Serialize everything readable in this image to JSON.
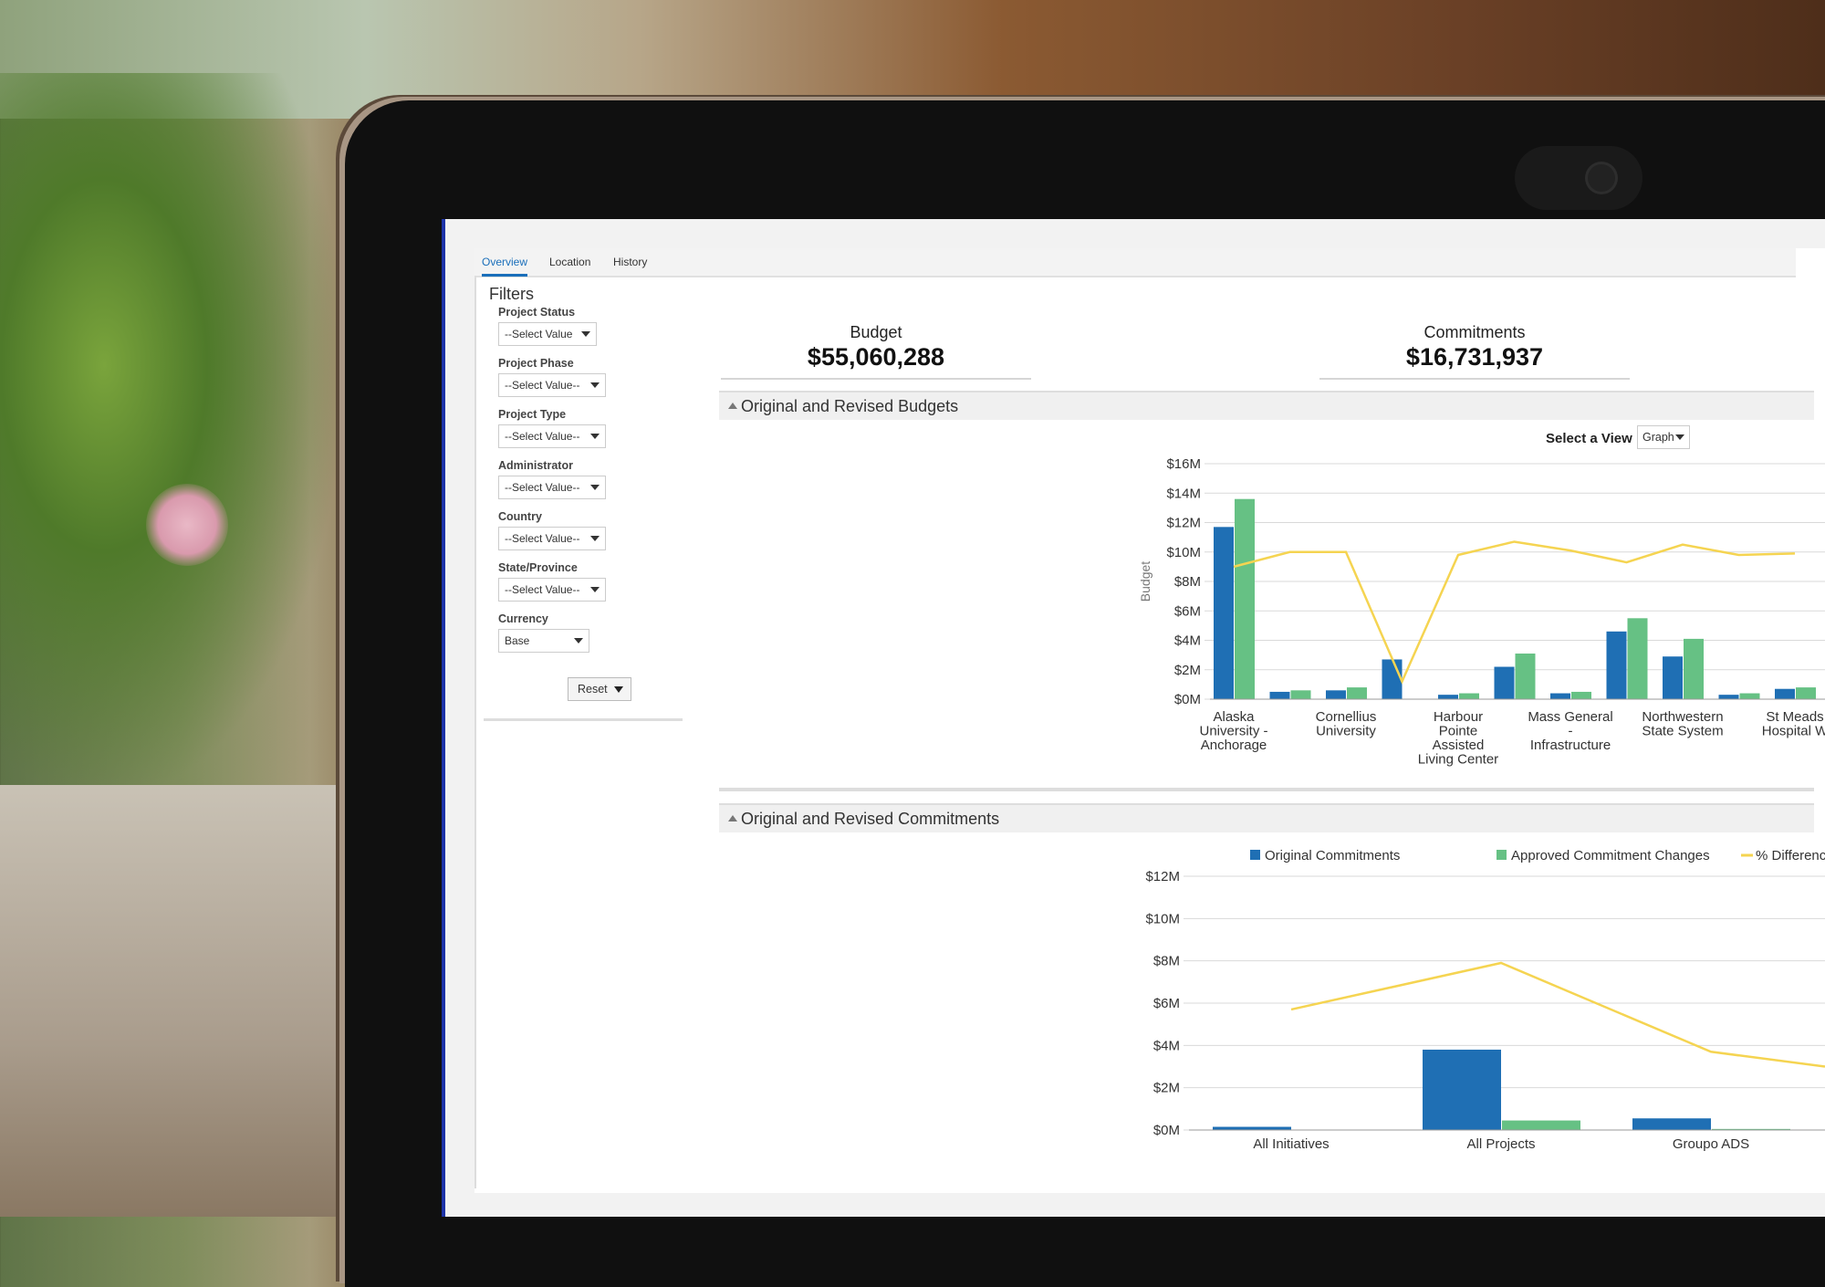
{
  "tabs": [
    {
      "label": "Overview",
      "active": true
    },
    {
      "label": "Location",
      "active": false
    },
    {
      "label": "History",
      "active": false
    }
  ],
  "filters": {
    "title": "Filters",
    "fields": [
      {
        "label": "Project Status",
        "value": "--Select Value"
      },
      {
        "label": "Project Phase",
        "value": "--Select Value--"
      },
      {
        "label": "Project Type",
        "value": "--Select Value--"
      },
      {
        "label": "Administrator",
        "value": "--Select Value--"
      },
      {
        "label": "Country",
        "value": "--Select Value--"
      },
      {
        "label": "State/Province",
        "value": "--Select Value--"
      },
      {
        "label": "Currency",
        "value": "Base"
      }
    ],
    "reset_label": "Reset"
  },
  "kpis": {
    "budget": {
      "label": "Budget",
      "value": "$55,060,288"
    },
    "commitments": {
      "label": "Commitments",
      "value": "$16,731,937"
    }
  },
  "sections": {
    "budgets_title": "Original and Revised Budgets",
    "commitments_title": "Original and Revised Commitments"
  },
  "view_select": {
    "label": "Select a View",
    "value": "Graph"
  },
  "colors": {
    "original": "#1f6fb4",
    "revised": "#66c184",
    "line": "#f5d451"
  },
  "chart_data": [
    {
      "type": "bar",
      "ylabel": "Budget",
      "ylim": [
        0,
        16
      ],
      "yticks": [
        "$0M",
        "$2M",
        "$4M",
        "$6M",
        "$8M",
        "$10M",
        "$12M",
        "$14M",
        "$16M"
      ],
      "categories": [
        "Alaska University - Anchorage",
        "",
        "Cornellius University",
        "",
        "Harbour Pointe Assisted Living Center",
        "",
        "Mass General - Infrastructure",
        "",
        "Northwestern State System",
        "",
        "St Meads Hospital W"
      ],
      "category_labels": [
        [
          "Alaska",
          "University -",
          "Anchorage"
        ],
        [],
        [
          "Cornellius",
          "University"
        ],
        [],
        [
          "Harbour",
          "Pointe",
          "Assisted",
          "Living Center"
        ],
        [],
        [
          "Mass General",
          "-",
          "Infrastructure"
        ],
        [],
        [
          "Northwestern",
          "State System"
        ],
        [],
        [
          "St Meads",
          "Hospital W"
        ]
      ],
      "series": [
        {
          "values": [
            11.7,
            0.5,
            0.6,
            2.7,
            0.3,
            2.2,
            0.4,
            4.6,
            2.9,
            0.3,
            0.7
          ]
        },
        {
          "values": [
            13.6,
            0.6,
            0.8,
            0.0,
            0.4,
            3.1,
            0.5,
            5.5,
            4.1,
            0.4,
            0.8
          ]
        },
        {
          "type": "line",
          "values": [
            9.0,
            10.0,
            10.0,
            1.2,
            9.8,
            10.7,
            10.1,
            9.3,
            10.5,
            9.8,
            9.9
          ]
        }
      ]
    },
    {
      "type": "bar",
      "ylim": [
        0,
        12
      ],
      "yticks": [
        "$0M",
        "$2M",
        "$4M",
        "$6M",
        "$8M",
        "$10M",
        "$12M"
      ],
      "categories": [
        "All Initiatives",
        "All Projects",
        "Groupo ADS"
      ],
      "legend": [
        "Original Commitments",
        "Approved Commitment Changes",
        "% Differenc"
      ],
      "series": [
        {
          "name": "Original Commitments",
          "values": [
            0.15,
            3.8,
            0.55
          ]
        },
        {
          "name": "Approved Commitment Changes",
          "values": [
            0.0,
            0.45,
            0.05
          ]
        },
        {
          "name": "% Differenc",
          "type": "line",
          "values": [
            5.7,
            7.9,
            3.7
          ]
        }
      ]
    }
  ]
}
